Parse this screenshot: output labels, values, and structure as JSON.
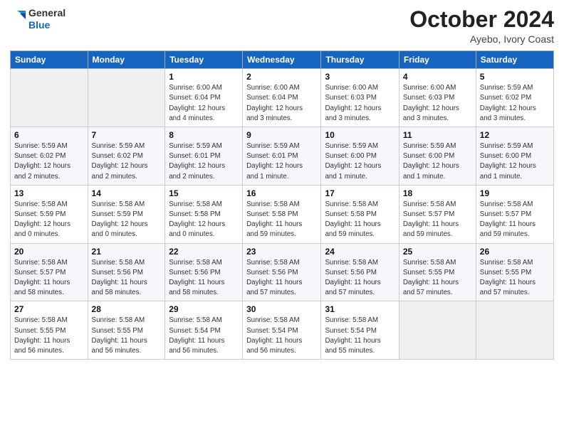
{
  "logo": {
    "line1": "General",
    "line2": "Blue"
  },
  "title": "October 2024",
  "subtitle": "Ayebo, Ivory Coast",
  "days_of_week": [
    "Sunday",
    "Monday",
    "Tuesday",
    "Wednesday",
    "Thursday",
    "Friday",
    "Saturday"
  ],
  "weeks": [
    [
      {
        "day": "",
        "info": ""
      },
      {
        "day": "",
        "info": ""
      },
      {
        "day": "1",
        "info": "Sunrise: 6:00 AM\nSunset: 6:04 PM\nDaylight: 12 hours\nand 4 minutes."
      },
      {
        "day": "2",
        "info": "Sunrise: 6:00 AM\nSunset: 6:04 PM\nDaylight: 12 hours\nand 3 minutes."
      },
      {
        "day": "3",
        "info": "Sunrise: 6:00 AM\nSunset: 6:03 PM\nDaylight: 12 hours\nand 3 minutes."
      },
      {
        "day": "4",
        "info": "Sunrise: 6:00 AM\nSunset: 6:03 PM\nDaylight: 12 hours\nand 3 minutes."
      },
      {
        "day": "5",
        "info": "Sunrise: 5:59 AM\nSunset: 6:02 PM\nDaylight: 12 hours\nand 3 minutes."
      }
    ],
    [
      {
        "day": "6",
        "info": "Sunrise: 5:59 AM\nSunset: 6:02 PM\nDaylight: 12 hours\nand 2 minutes."
      },
      {
        "day": "7",
        "info": "Sunrise: 5:59 AM\nSunset: 6:02 PM\nDaylight: 12 hours\nand 2 minutes."
      },
      {
        "day": "8",
        "info": "Sunrise: 5:59 AM\nSunset: 6:01 PM\nDaylight: 12 hours\nand 2 minutes."
      },
      {
        "day": "9",
        "info": "Sunrise: 5:59 AM\nSunset: 6:01 PM\nDaylight: 12 hours\nand 1 minute."
      },
      {
        "day": "10",
        "info": "Sunrise: 5:59 AM\nSunset: 6:00 PM\nDaylight: 12 hours\nand 1 minute."
      },
      {
        "day": "11",
        "info": "Sunrise: 5:59 AM\nSunset: 6:00 PM\nDaylight: 12 hours\nand 1 minute."
      },
      {
        "day": "12",
        "info": "Sunrise: 5:59 AM\nSunset: 6:00 PM\nDaylight: 12 hours\nand 1 minute."
      }
    ],
    [
      {
        "day": "13",
        "info": "Sunrise: 5:58 AM\nSunset: 5:59 PM\nDaylight: 12 hours\nand 0 minutes."
      },
      {
        "day": "14",
        "info": "Sunrise: 5:58 AM\nSunset: 5:59 PM\nDaylight: 12 hours\nand 0 minutes."
      },
      {
        "day": "15",
        "info": "Sunrise: 5:58 AM\nSunset: 5:58 PM\nDaylight: 12 hours\nand 0 minutes."
      },
      {
        "day": "16",
        "info": "Sunrise: 5:58 AM\nSunset: 5:58 PM\nDaylight: 11 hours\nand 59 minutes."
      },
      {
        "day": "17",
        "info": "Sunrise: 5:58 AM\nSunset: 5:58 PM\nDaylight: 11 hours\nand 59 minutes."
      },
      {
        "day": "18",
        "info": "Sunrise: 5:58 AM\nSunset: 5:57 PM\nDaylight: 11 hours\nand 59 minutes."
      },
      {
        "day": "19",
        "info": "Sunrise: 5:58 AM\nSunset: 5:57 PM\nDaylight: 11 hours\nand 59 minutes."
      }
    ],
    [
      {
        "day": "20",
        "info": "Sunrise: 5:58 AM\nSunset: 5:57 PM\nDaylight: 11 hours\nand 58 minutes."
      },
      {
        "day": "21",
        "info": "Sunrise: 5:58 AM\nSunset: 5:56 PM\nDaylight: 11 hours\nand 58 minutes."
      },
      {
        "day": "22",
        "info": "Sunrise: 5:58 AM\nSunset: 5:56 PM\nDaylight: 11 hours\nand 58 minutes."
      },
      {
        "day": "23",
        "info": "Sunrise: 5:58 AM\nSunset: 5:56 PM\nDaylight: 11 hours\nand 57 minutes."
      },
      {
        "day": "24",
        "info": "Sunrise: 5:58 AM\nSunset: 5:56 PM\nDaylight: 11 hours\nand 57 minutes."
      },
      {
        "day": "25",
        "info": "Sunrise: 5:58 AM\nSunset: 5:55 PM\nDaylight: 11 hours\nand 57 minutes."
      },
      {
        "day": "26",
        "info": "Sunrise: 5:58 AM\nSunset: 5:55 PM\nDaylight: 11 hours\nand 57 minutes."
      }
    ],
    [
      {
        "day": "27",
        "info": "Sunrise: 5:58 AM\nSunset: 5:55 PM\nDaylight: 11 hours\nand 56 minutes."
      },
      {
        "day": "28",
        "info": "Sunrise: 5:58 AM\nSunset: 5:55 PM\nDaylight: 11 hours\nand 56 minutes."
      },
      {
        "day": "29",
        "info": "Sunrise: 5:58 AM\nSunset: 5:54 PM\nDaylight: 11 hours\nand 56 minutes."
      },
      {
        "day": "30",
        "info": "Sunrise: 5:58 AM\nSunset: 5:54 PM\nDaylight: 11 hours\nand 56 minutes."
      },
      {
        "day": "31",
        "info": "Sunrise: 5:58 AM\nSunset: 5:54 PM\nDaylight: 11 hours\nand 55 minutes."
      },
      {
        "day": "",
        "info": ""
      },
      {
        "day": "",
        "info": ""
      }
    ]
  ],
  "accent_color": "#1565c0"
}
